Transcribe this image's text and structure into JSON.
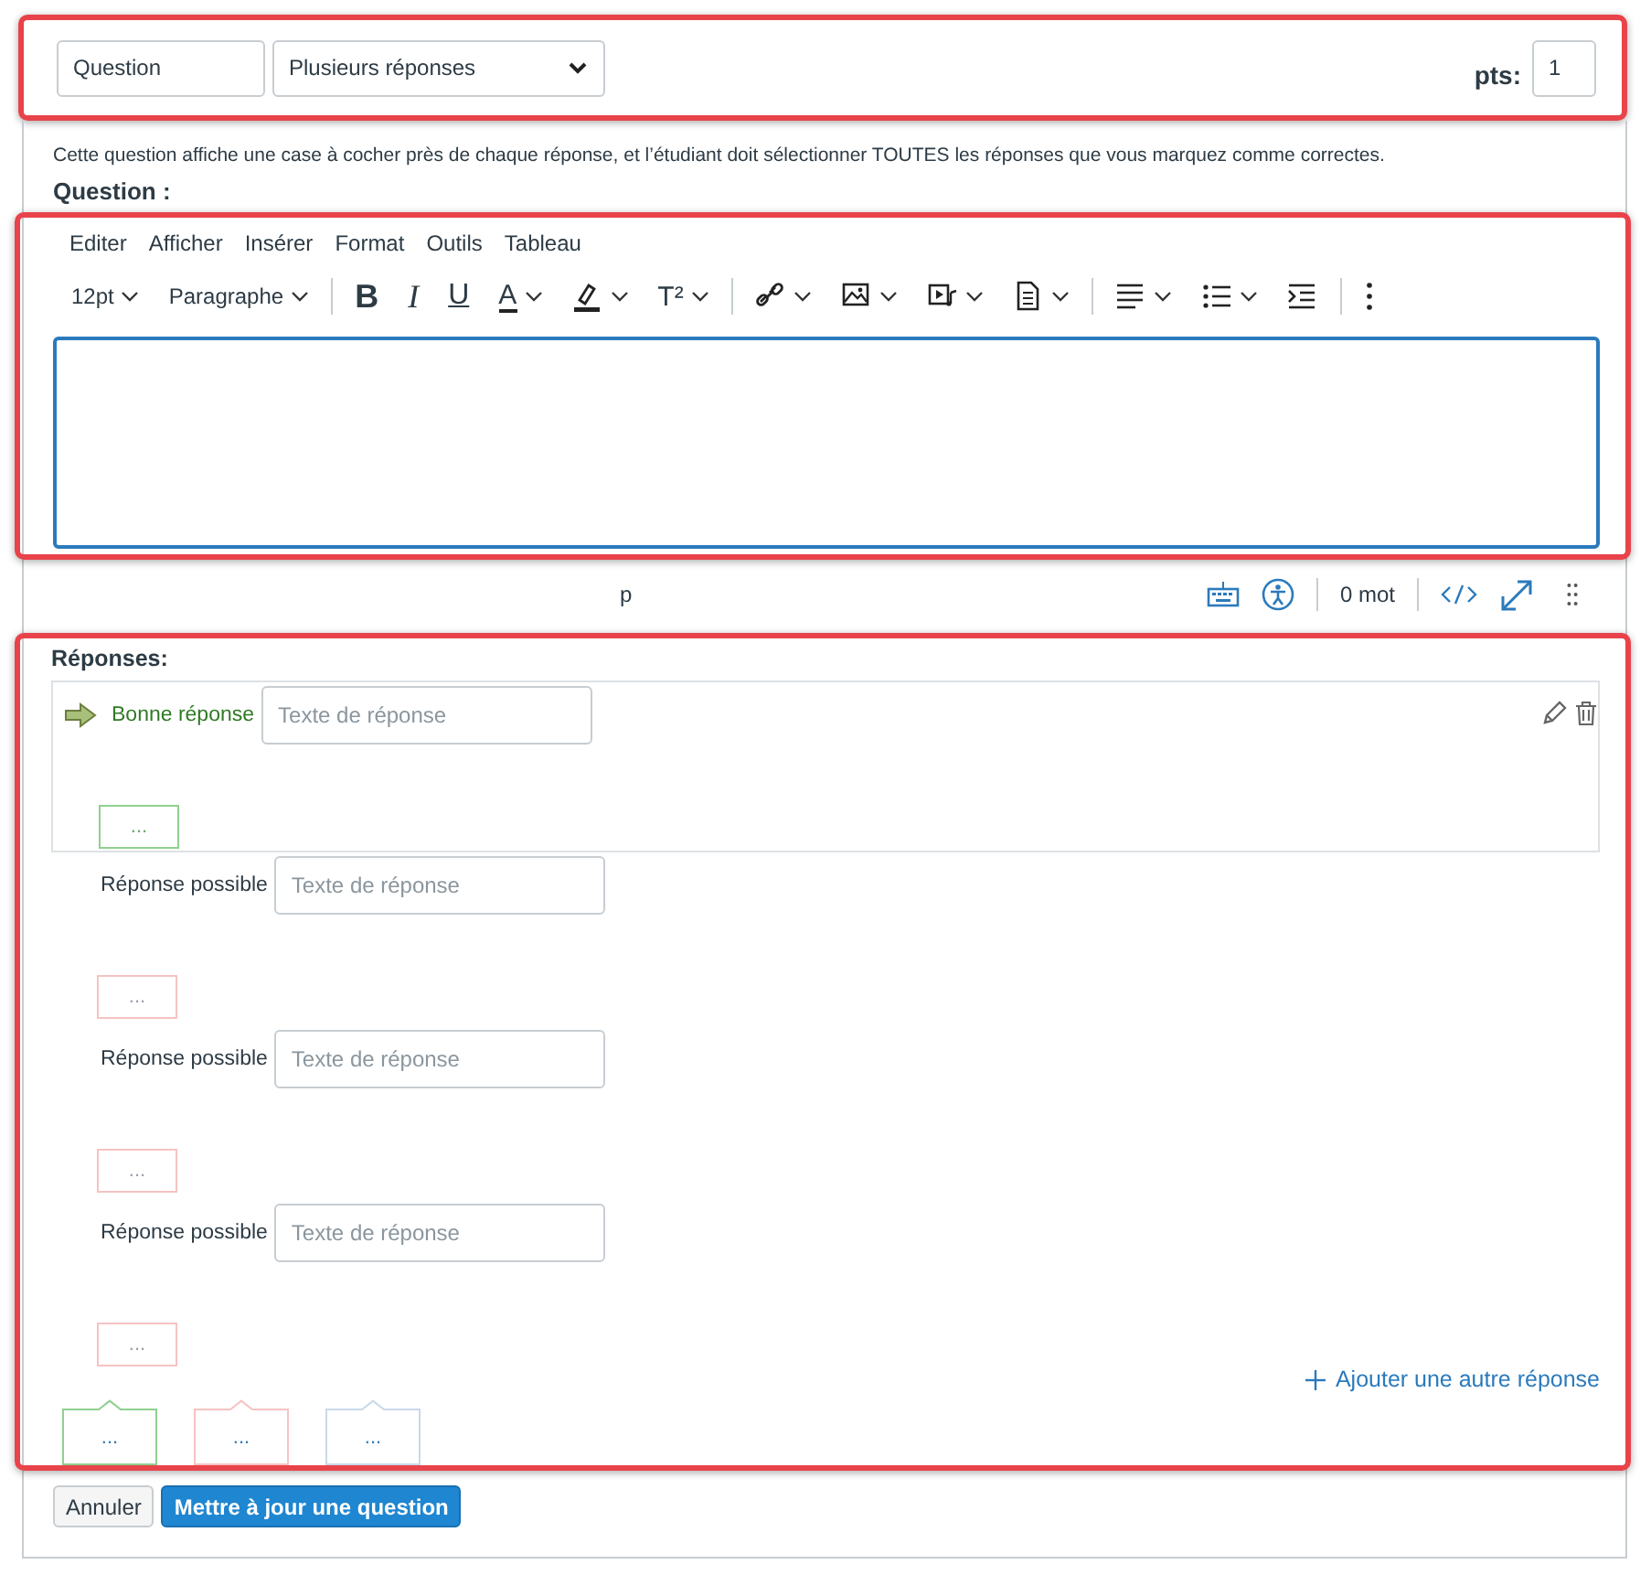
{
  "question_name": {
    "value": "Question"
  },
  "question_type": {
    "value": "Plusieurs réponses"
  },
  "points": {
    "label": "pts:",
    "value": "1"
  },
  "description": "Cette question affiche une case à cocher près de chaque réponse, et l’étudiant doit sélectionner TOUTES les réponses que vous marquez comme correctes.",
  "question_label": "Question :",
  "editor": {
    "menu": [
      "Editer",
      "Afficher",
      "Insérer",
      "Format",
      "Outils",
      "Tableau"
    ],
    "toolbar": [
      {
        "kind": "dropdown",
        "text": "12pt",
        "menu": true
      },
      {
        "kind": "dropdown",
        "text": "Paragraphe",
        "menu": true
      },
      {
        "kind": "separator"
      },
      {
        "kind": "bold",
        "text": "B",
        "menu": false
      },
      {
        "kind": "italic",
        "text": "I",
        "menu": false
      },
      {
        "kind": "underline",
        "text": "U",
        "menu": false
      },
      {
        "kind": "textcolor",
        "text": "A",
        "menu": true
      },
      {
        "kind": "highlight",
        "menu": true
      },
      {
        "kind": "superscript",
        "text": "T²",
        "menu": true
      },
      {
        "kind": "separator"
      },
      {
        "kind": "link",
        "menu": true
      },
      {
        "kind": "image",
        "menu": true
      },
      {
        "kind": "media",
        "menu": true
      },
      {
        "kind": "document",
        "menu": true
      },
      {
        "kind": "separator"
      },
      {
        "kind": "align",
        "menu": true
      },
      {
        "kind": "list",
        "menu": true
      },
      {
        "kind": "indent",
        "menu": false
      },
      {
        "kind": "separator"
      },
      {
        "kind": "more",
        "menu": false
      }
    ],
    "path": "p",
    "word_count": "0 mot"
  },
  "answers_label": "Réponses:",
  "answers": [
    {
      "kind": "correct",
      "label": "Bonne réponse",
      "placeholder": "Texte de réponse",
      "comment": "..."
    },
    {
      "kind": "possible",
      "label": "Réponse possible",
      "placeholder": "Texte de réponse",
      "comment": "..."
    },
    {
      "kind": "possible",
      "label": "Réponse possible",
      "placeholder": "Texte de réponse",
      "comment": "..."
    },
    {
      "kind": "possible",
      "label": "Réponse possible",
      "placeholder": "Texte de réponse",
      "comment": "..."
    }
  ],
  "add_answer": "Ajouter une autre réponse",
  "comment_buttons": [
    {
      "text": "...",
      "color": "#8fd08f"
    },
    {
      "text": "...",
      "color": "#f6c3c3"
    },
    {
      "text": "...",
      "color": "#c9d9ea"
    }
  ],
  "buttons": [
    {
      "kind": "secondary",
      "label": "Annuler"
    },
    {
      "kind": "primary",
      "label": "Mettre à jour une question"
    }
  ]
}
